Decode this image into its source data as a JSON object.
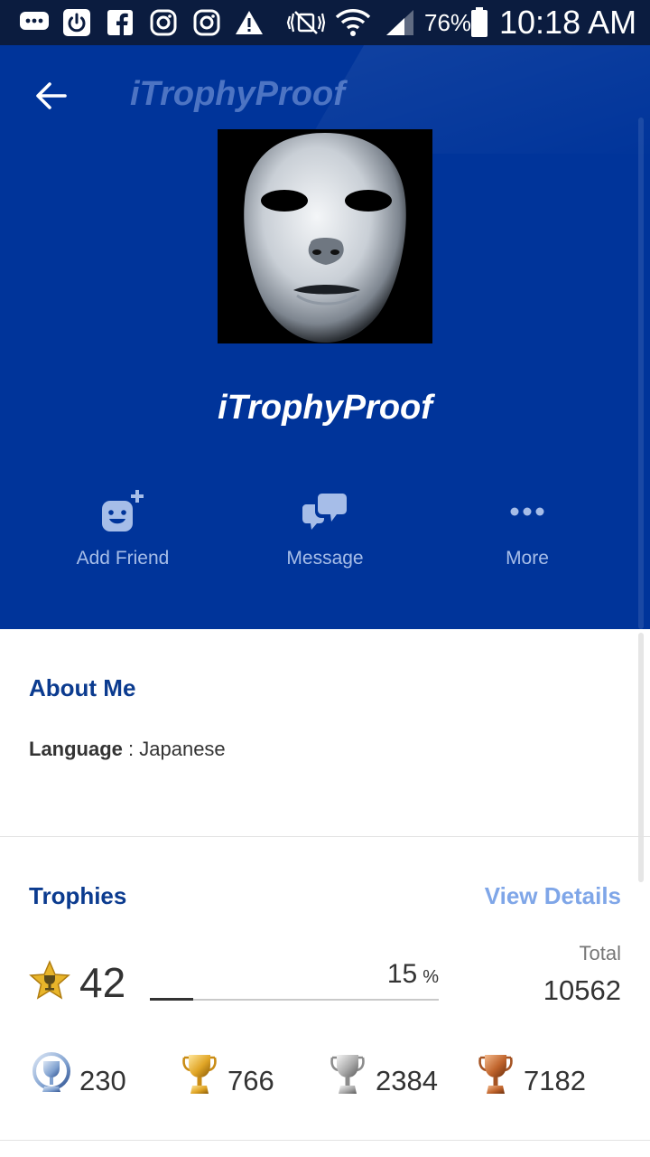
{
  "status_bar": {
    "battery": "76%",
    "time": "10:18 AM",
    "icons": [
      "message-icon",
      "power-icon",
      "facebook-icon",
      "instagram-icon",
      "instagram-icon",
      "warning-icon",
      "mute-icon",
      "wifi-icon",
      "signal-icon",
      "battery-icon"
    ]
  },
  "header": {
    "title": "iTrophyProof",
    "back_icon": "arrow-left-icon",
    "bg_color": "#00349a"
  },
  "profile": {
    "name": "iTrophyProof",
    "avatar": "white-mask-avatar"
  },
  "actions": [
    {
      "label": "Add Friend",
      "icon": "add-friend-icon"
    },
    {
      "label": "Message",
      "icon": "message-bubbles-icon"
    },
    {
      "label": "More",
      "icon": "more-dots-icon"
    }
  ],
  "about": {
    "title": "About Me",
    "language_label": "Language",
    "separator": " : ",
    "language_value": "Japanese"
  },
  "trophies": {
    "title": "Trophies",
    "view_details": "View Details",
    "level": "42",
    "progress": "15",
    "progress_unit": "%",
    "progress_fraction": 0.15,
    "total_label": "Total",
    "total_value": "10562",
    "counts": [
      {
        "type": "platinum",
        "value": "230",
        "icon": "platinum-trophy-icon"
      },
      {
        "type": "gold",
        "value": "766",
        "icon": "gold-trophy-icon"
      },
      {
        "type": "silver",
        "value": "2384",
        "icon": "silver-trophy-icon"
      },
      {
        "type": "bronze",
        "value": "7182",
        "icon": "bronze-trophy-icon"
      }
    ]
  },
  "colors": {
    "primary": "#00349a",
    "section_title": "#0b3b8f",
    "link": "#7fa6e8",
    "status_bar": "#0b1c3f"
  }
}
